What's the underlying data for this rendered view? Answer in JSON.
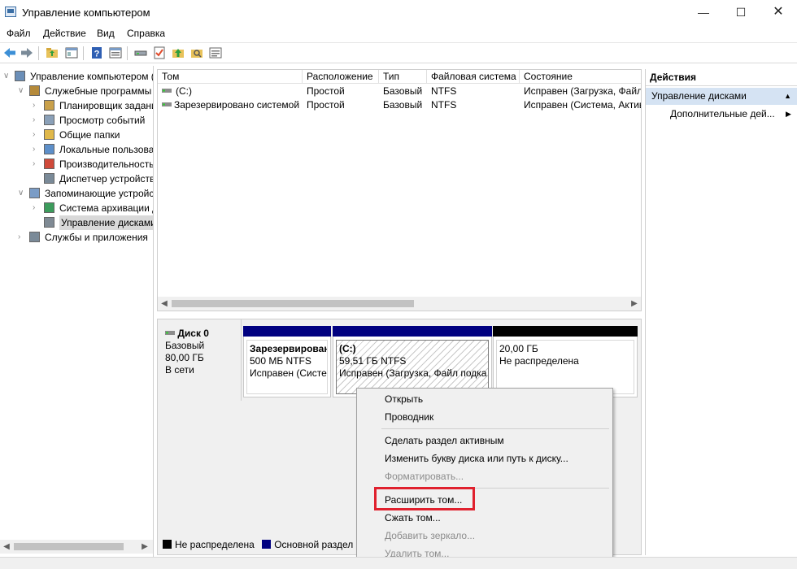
{
  "window": {
    "title": "Управление компьютером",
    "minimize": "—",
    "maximize": "☐",
    "close": "✕"
  },
  "menu": [
    "Файл",
    "Действие",
    "Вид",
    "Справка"
  ],
  "toolbar": {
    "icons": [
      "back-arrow-icon",
      "forward-arrow-icon",
      "up-folder-icon",
      "show-hide-tree-icon",
      "help-icon",
      "properties-icon",
      "disk-icon",
      "checklist-icon",
      "upload-icon",
      "search-folder-icon",
      "details-view-icon"
    ]
  },
  "tree": {
    "items": [
      {
        "label": "Управление компьютером (л",
        "level": 0,
        "expanded": "open",
        "icon": "computer-icon"
      },
      {
        "label": "Служебные программы",
        "level": 1,
        "expanded": "open",
        "icon": "tools-icon"
      },
      {
        "label": "Планировщик заданий",
        "level": 2,
        "expanded": "closed",
        "icon": "clock-icon"
      },
      {
        "label": "Просмотр событий",
        "level": 2,
        "expanded": "closed",
        "icon": "event-viewer-icon"
      },
      {
        "label": "Общие папки",
        "level": 2,
        "expanded": "closed",
        "icon": "shared-folder-icon"
      },
      {
        "label": "Локальные пользовате",
        "level": 2,
        "expanded": "closed",
        "icon": "users-icon"
      },
      {
        "label": "Производительность",
        "level": 2,
        "expanded": "closed",
        "icon": "performance-icon"
      },
      {
        "label": "Диспетчер устройств",
        "level": 2,
        "expanded": "none",
        "icon": "device-manager-icon"
      },
      {
        "label": "Запоминающие устройст",
        "level": 1,
        "expanded": "open",
        "icon": "storage-icon"
      },
      {
        "label": "Система архивации да",
        "level": 2,
        "expanded": "closed",
        "icon": "backup-icon"
      },
      {
        "label": "Управление дисками",
        "level": 2,
        "expanded": "none",
        "icon": "disk-management-icon",
        "selected": true
      },
      {
        "label": "Службы и приложения",
        "level": 1,
        "expanded": "closed",
        "icon": "services-icon"
      }
    ]
  },
  "volumes": {
    "columns": [
      "Том",
      "Расположение",
      "Тип",
      "Файловая система",
      "Состояние"
    ],
    "rows": [
      [
        "(C:)",
        "Простой",
        "Базовый",
        "NTFS",
        "Исправен (Загрузка, Файл"
      ],
      [
        "Зарезервировано системой",
        "Простой",
        "Базовый",
        "NTFS",
        "Исправен (Система, Актив"
      ]
    ]
  },
  "disk": {
    "name": "Диск 0",
    "type": "Базовый",
    "size": "80,00 ГБ",
    "status": "В сети",
    "partitions": [
      {
        "title": "Зарезервирован",
        "size": "500 МБ NTFS",
        "state": "Исправен (Систе",
        "bar_color": "#000080"
      },
      {
        "title": "(C:)",
        "size": "59,51 ГБ NTFS",
        "state": "Исправен (Загрузка, Файл подка",
        "bar_color": "#000080"
      },
      {
        "title": "",
        "size": "20,00 ГБ",
        "state": "Не распределена",
        "bar_color": "#000000"
      }
    ]
  },
  "legend": [
    {
      "label": "Не распределена",
      "color": "#000000"
    },
    {
      "label": "Основной раздел",
      "color": "#000080"
    }
  ],
  "actions": {
    "header": "Действия",
    "section": "Управление дисками",
    "more": "Дополнительные дей..."
  },
  "context_menu": {
    "items": [
      {
        "label": "Открыть",
        "enabled": true
      },
      {
        "label": "Проводник",
        "enabled": true
      },
      {
        "label": "Сделать раздел активным",
        "enabled": true
      },
      {
        "label": "Изменить букву диска или путь к диску...",
        "enabled": true
      },
      {
        "label": "Форматировать...",
        "enabled": false
      },
      {
        "label": "Расширить том...",
        "enabled": true,
        "highlighted": true
      },
      {
        "label": "Сжать том...",
        "enabled": true
      },
      {
        "label": "Добавить зеркало...",
        "enabled": false
      },
      {
        "label": "Удалить том...",
        "enabled": false
      }
    ],
    "highlight_color": "#e0212e"
  }
}
